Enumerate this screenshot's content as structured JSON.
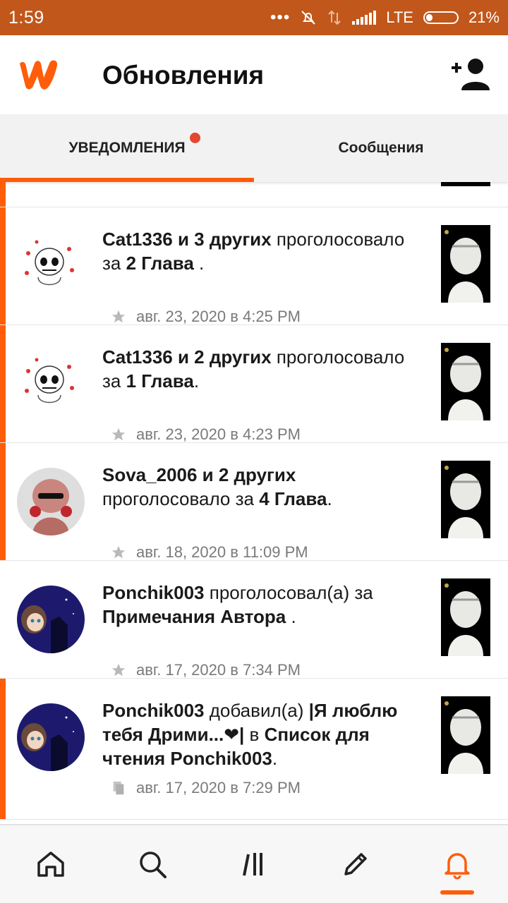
{
  "status_bar": {
    "time": "1:59",
    "network": "LTE",
    "battery": "21%",
    "battery_level": 0.21,
    "icons": [
      "more-dots-icon",
      "muted-bell-icon",
      "data-arrows-icon",
      "signal-icon",
      "battery-icon"
    ]
  },
  "header": {
    "title": "Обновления",
    "logo_icon": "wattpad-logo-icon",
    "action_icon": "add-user-icon"
  },
  "tabs": [
    {
      "label": "УВЕДОМЛЕНИЯ",
      "active": true,
      "has_dot": true
    },
    {
      "label": "Сообщения",
      "active": false,
      "has_dot": false
    }
  ],
  "notifications": [
    {
      "segments": [
        {
          "t": "Cat1336 и 3 других",
          "b": true
        },
        {
          "t": " проголосовало за ",
          "b": false
        },
        {
          "t": "2 Глава",
          "b": true
        },
        {
          "t": " .",
          "b": false
        }
      ],
      "time": "авг. 23, 2020 в 4:25 PM",
      "icon": "star-icon",
      "unread": true
    },
    {
      "segments": [
        {
          "t": "Cat1336 и 2 других",
          "b": true
        },
        {
          "t": " проголосовало за ",
          "b": false
        },
        {
          "t": "1 Глава",
          "b": true
        },
        {
          "t": ".",
          "b": false
        }
      ],
      "time": "авг. 23, 2020 в 4:23 PM",
      "icon": "star-icon",
      "unread": true
    },
    {
      "segments": [
        {
          "t": "Sova_2006 и 2 других",
          "b": true
        },
        {
          "t": " проголосовало за ",
          "b": false
        },
        {
          "t": "4 Глава",
          "b": true
        },
        {
          "t": ".",
          "b": false
        }
      ],
      "time": "авг. 18, 2020 в 11:09 PM",
      "icon": "star-icon",
      "unread": true
    },
    {
      "segments": [
        {
          "t": "Ponchik003",
          "b": true
        },
        {
          "t": " проголосовал(а) за ",
          "b": false
        },
        {
          "t": "Примечания Автора",
          "b": true
        },
        {
          "t": " .",
          "b": false
        }
      ],
      "time": "авг. 17, 2020 в 7:34 PM",
      "icon": "star-icon",
      "unread": false
    },
    {
      "segments": [
        {
          "t": "Ponchik003",
          "b": true
        },
        {
          "t": " добавил(а) ",
          "b": false
        },
        {
          "t": "|Я люблю тебя Дрими...❤|",
          "b": true
        },
        {
          "t": " в ",
          "b": false
        },
        {
          "t": "Список для чтения Ponchik003",
          "b": true
        },
        {
          "t": ".",
          "b": false
        }
      ],
      "time": "авг. 17, 2020 в 7:29 PM",
      "icon": "reading-list-icon",
      "unread": true
    }
  ],
  "bottom_nav": [
    {
      "icon": "home-icon",
      "active": false
    },
    {
      "icon": "search-icon",
      "active": false
    },
    {
      "icon": "library-icon",
      "active": false
    },
    {
      "icon": "pencil-icon",
      "active": false
    },
    {
      "icon": "bell-icon",
      "active": true
    }
  ],
  "colors": {
    "status_bar": "#c1571a",
    "accent": "#ff5d0a",
    "tab_dot": "#e2472f",
    "tab_bar": "#f3f2f2"
  }
}
